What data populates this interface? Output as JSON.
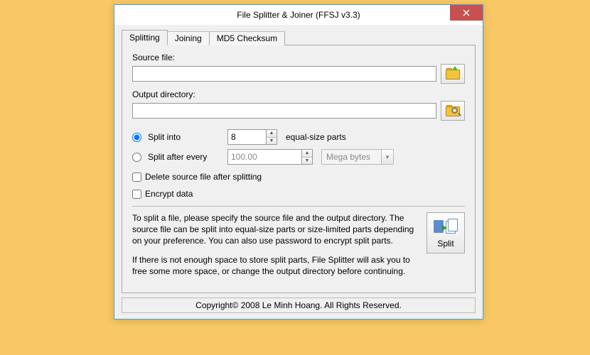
{
  "window": {
    "title": "File Splitter & Joiner (FFSJ v3.3)"
  },
  "tabs": [
    {
      "label": "Splitting",
      "active": true
    },
    {
      "label": "Joining",
      "active": false
    },
    {
      "label": "MD5 Checksum",
      "active": false
    }
  ],
  "labels": {
    "source_file": "Source file:",
    "output_dir": "Output directory:"
  },
  "fields": {
    "source_file": "",
    "output_dir": ""
  },
  "split_mode": {
    "into": {
      "label": "Split into",
      "value": "8",
      "suffix": "equal-size parts",
      "selected": true
    },
    "after": {
      "label": "Split after every",
      "value": "100.00",
      "unit": "Mega bytes",
      "selected": false
    }
  },
  "options": {
    "delete_source": {
      "label": "Delete source file after splitting",
      "checked": false
    },
    "encrypt": {
      "label": "Encrypt data",
      "checked": false
    }
  },
  "help": {
    "p1": "To split a file, please specify the source file and the output directory. The source file can be split into equal-size parts or size-limited parts depending on your preference. You can also use password to encrypt split parts.",
    "p2": "If there is not enough space to store split parts, File Splitter will ask you to free some more space, or change the output directory before continuing."
  },
  "buttons": {
    "split": "Split"
  },
  "footer": "Copyright© 2008 Le Minh Hoang. All Rights Reserved."
}
